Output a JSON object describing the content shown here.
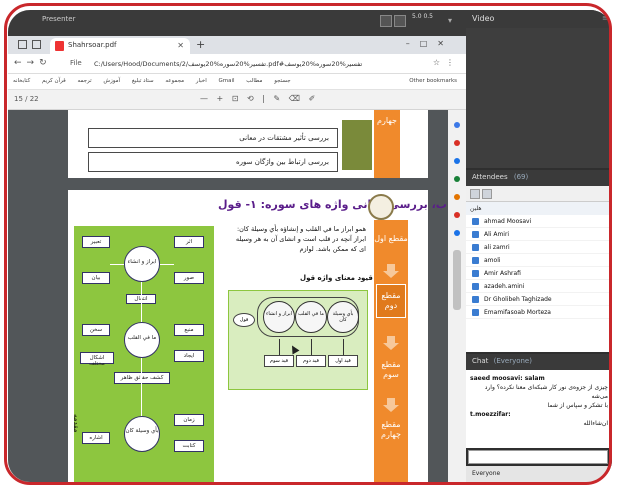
{
  "presenter_bar": {
    "tag": "Presenter",
    "zoom": "5.0\n0.5"
  },
  "browser": {
    "tab_title": "Shahrsoar.pdf",
    "file_label": "File",
    "url": "C:/Users/Hood/Documents/تفسیر%20سوره%20یوسف/2.pdf#تفسیر%20سوره%20یوسف",
    "bookmarks": [
      "کتابخانه",
      "قرآن کریم",
      "ترجمه",
      "آموزش",
      "ستاد تبلیغ",
      "مجموعه",
      "اخبار",
      "Gmail",
      "مطالب",
      "جستجو"
    ],
    "other_bookmarks": "Other bookmarks",
    "pdf_page": "15 / 22",
    "tools": "— + ⊡ ⟲ | ✎ ⌫ ✐"
  },
  "page1": {
    "items": [
      "بررسی تأثیر مشتقات در معانی",
      "بررسی ارتباط بین واژگان سوره"
    ],
    "orange_label": "جهارم"
  },
  "page2": {
    "title": "الف و ب، بررسی معانی واژه های سوره: ۱- قول",
    "quote": "همو ابراز ما في القلب و إنشاؤه بأي وسيلة كان: ابراز آنچه در قلب است و انشای آن به هر وسیله ای که ممکن باشد. لوازم",
    "subhead": "قیود معنای واژه قول",
    "steps": [
      "مقطع اول",
      "مقطع دوم",
      "مقطع سوم",
      "مقطع چهارم"
    ],
    "side_label": "مقدمه",
    "green_nodes": [
      "ابراز و انشاء",
      "تعبیر",
      "بیان",
      "اثر",
      "انتقال",
      "صور",
      "ما في القلب",
      "منبع",
      "سخن",
      "ایجاد",
      "اشكال مختلف",
      "كشف حقائق ظاهر",
      "بأي وسيلة كان",
      "زمان",
      "اشاره",
      "كتابت"
    ],
    "diagram_circles": [
      "ابراز و انشاء",
      "ما في القلب",
      "بأي وسيلة كان"
    ],
    "diagram_kul": "قول",
    "diagram_qayd": [
      "قید اول",
      "قید دوم",
      "قید سوم"
    ]
  },
  "right": {
    "video_title": "Video",
    "attendees_title": "Attendees",
    "attendees_count": "(69)",
    "group_label": "هلین",
    "attendees": [
      "ahmad Moosavi",
      "Ali Amiri",
      "ali zamri",
      "amoli",
      "Amir Ashrafi",
      "azadeh.amini",
      "Dr Gholibeh Taghizade",
      "Emamifasoab Morteza"
    ],
    "chat_title": "Chat",
    "chat_scope": "(Everyone)",
    "messages": [
      {
        "user": "saeed moosavi: salam",
        "text": "چیزی از جزوه‌ی نور کار شبکه‌ای معنا نکرده؟ وارد می‌شه"
      },
      {
        "user": "",
        "text": "با تشکر و سپاس از شما"
      },
      {
        "user": "t.moezzifar:",
        "text": "ان‌شاء‌الله"
      }
    ],
    "chat_foot": "Everyone"
  }
}
